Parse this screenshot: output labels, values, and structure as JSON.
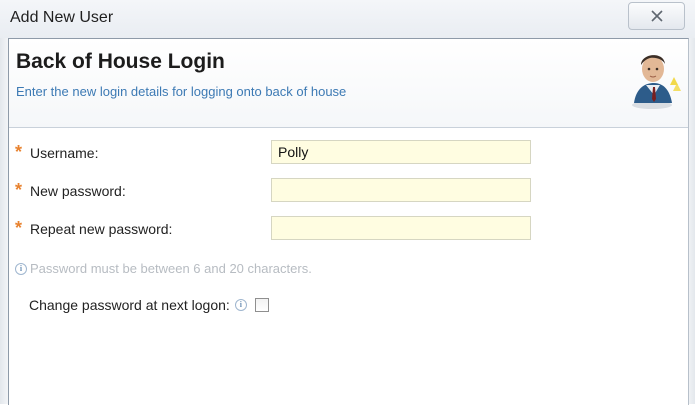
{
  "window": {
    "title": "Add New User",
    "close_icon": "close-icon"
  },
  "header": {
    "title": "Back of House Login",
    "subtitle": "Enter the new login details for logging onto back of house",
    "avatar_icon": "user-avatar-icon"
  },
  "form": {
    "required_marker": "*",
    "username": {
      "label": "Username:",
      "value": "Polly"
    },
    "new_password": {
      "label": "New password:",
      "value": ""
    },
    "repeat_password": {
      "label": "Repeat new password:",
      "value": ""
    },
    "hint": "Password must be between 6 and 20 characters.",
    "change_password": {
      "label": "Change password at next logon:",
      "checked": false
    }
  },
  "colors": {
    "required_star": "#e8822f",
    "subtitle": "#3c7ab4",
    "input_background": "#fffde1"
  }
}
